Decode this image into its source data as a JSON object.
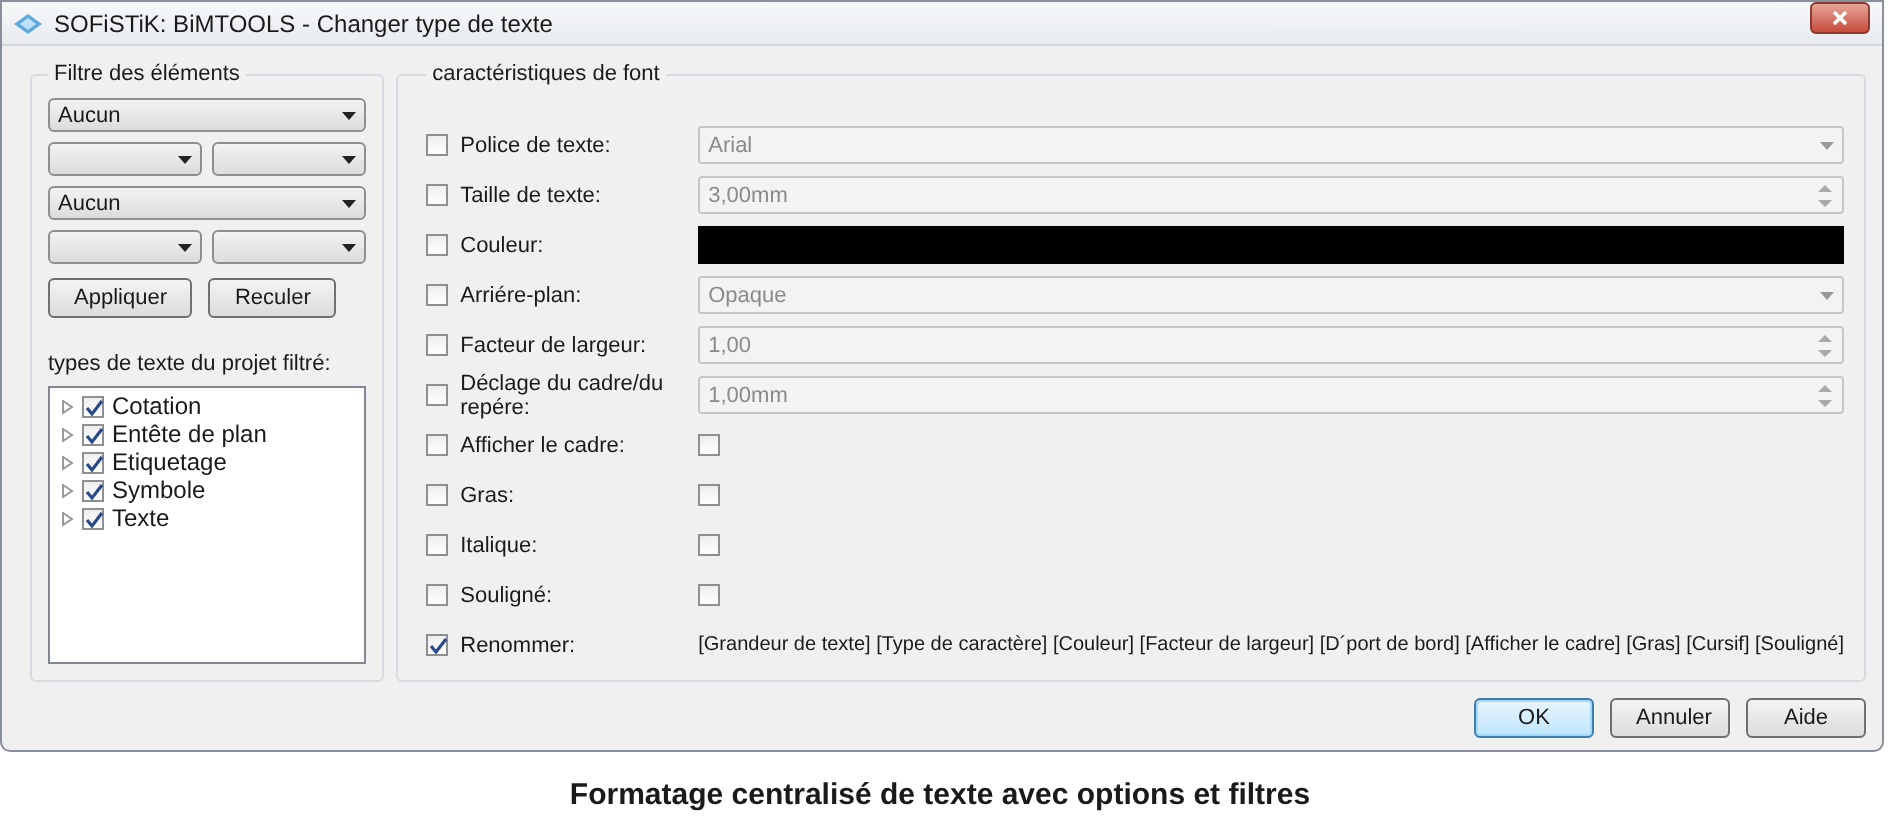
{
  "window": {
    "title": "SOFiSTiK: BiMTOOLS - Changer type de texte"
  },
  "filter": {
    "title": "Filtre des éléments",
    "dropdown_rows": [
      [
        {
          "value": "Aucun"
        }
      ],
      [
        {},
        {}
      ],
      [
        {
          "value": "Aucun"
        }
      ],
      [
        {},
        {}
      ]
    ],
    "buttons": [
      "Appliquer",
      "Reculer"
    ],
    "tree_label": "types de texte du projet filtré:",
    "tree": [
      {
        "label": "Cotation",
        "checked": true,
        "expanded": false
      },
      {
        "label": "Entête de plan",
        "checked": true,
        "expanded": false
      },
      {
        "label": "Etiquetage",
        "checked": true,
        "expanded": false
      },
      {
        "label": "Symbole",
        "checked": true,
        "expanded": false
      },
      {
        "label": "Texte",
        "checked": true,
        "expanded": false
      }
    ]
  },
  "font": {
    "title": "caractéristiques de font",
    "rows": [
      {
        "label": "Police de texte:",
        "checked": false,
        "kind": "combo",
        "value": "Arial"
      },
      {
        "label": "Taille de texte:",
        "checked": false,
        "kind": "spin",
        "value": "3,00mm"
      },
      {
        "label": "Couleur:",
        "checked": false,
        "kind": "color",
        "color": "#000000"
      },
      {
        "label": "Arriére-plan:",
        "checked": false,
        "kind": "combo",
        "value": "Opaque"
      },
      {
        "label": "Facteur de largeur:",
        "checked": false,
        "kind": "spin",
        "value": "1,00"
      },
      {
        "label": "Déclage du cadre/du repére:",
        "checked": false,
        "kind": "spin",
        "value": "1,00mm"
      },
      {
        "label": "Afficher le cadre:",
        "checked": false,
        "kind": "check",
        "value_checked": false
      },
      {
        "label": "Gras:",
        "checked": false,
        "kind": "check",
        "value_checked": false
      },
      {
        "label": "Italique:",
        "checked": false,
        "kind": "check",
        "value_checked": false
      },
      {
        "label": "Souligné:",
        "checked": false,
        "kind": "check",
        "value_checked": false
      },
      {
        "label": "Renommer:",
        "checked": true,
        "kind": "text",
        "value": "[Grandeur de texte] [Type de caractère] [Couleur] [Facteur de largeur] [D´port de bord] [Afficher le cadre] [Gras] [Cursif] [Souligné]"
      }
    ]
  },
  "dialog_buttons": [
    {
      "label": "OK",
      "default": true
    },
    {
      "label": "Annuler",
      "default": false
    },
    {
      "label": "Aide",
      "default": false
    }
  ],
  "caption": "Formatage centralisé de texte avec options et filtres"
}
